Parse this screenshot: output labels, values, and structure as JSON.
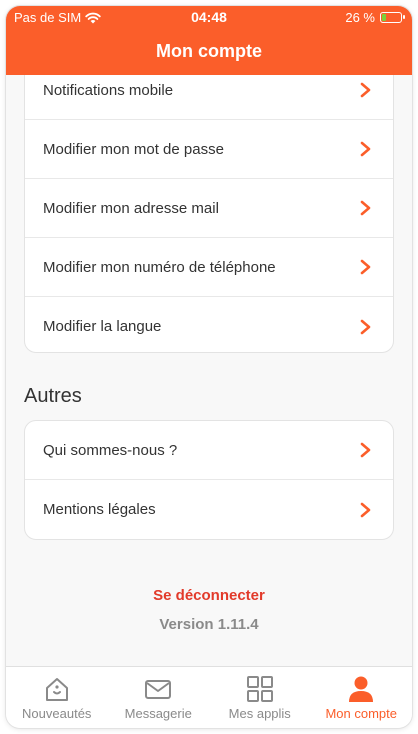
{
  "status_bar": {
    "carrier": "Pas de SIM",
    "time": "04:48",
    "battery": "26 %",
    "battery_level": 0.26
  },
  "header": {
    "title": "Mon compte"
  },
  "account_settings": [
    {
      "label": "Notifications mobile"
    },
    {
      "label": "Modifier mon mot de passe"
    },
    {
      "label": "Modifier mon adresse mail"
    },
    {
      "label": "Modifier mon numéro de téléphone"
    },
    {
      "label": "Modifier la langue"
    }
  ],
  "others": {
    "title": "Autres",
    "items": [
      {
        "label": "Qui sommes-nous ?"
      },
      {
        "label": "Mentions légales"
      }
    ]
  },
  "logout_label": "Se déconnecter",
  "version": "Version 1.11.4",
  "tabs": [
    {
      "label": "Nouveautés",
      "icon": "home-icon"
    },
    {
      "label": "Messagerie",
      "icon": "mail-icon"
    },
    {
      "label": "Mes applis",
      "icon": "grid-icon"
    },
    {
      "label": "Mon compte",
      "icon": "user-icon",
      "active": true
    }
  ],
  "colors": {
    "accent": "#fb5e2a",
    "logout": "#e23a2a",
    "battery": "#7cd13a"
  }
}
